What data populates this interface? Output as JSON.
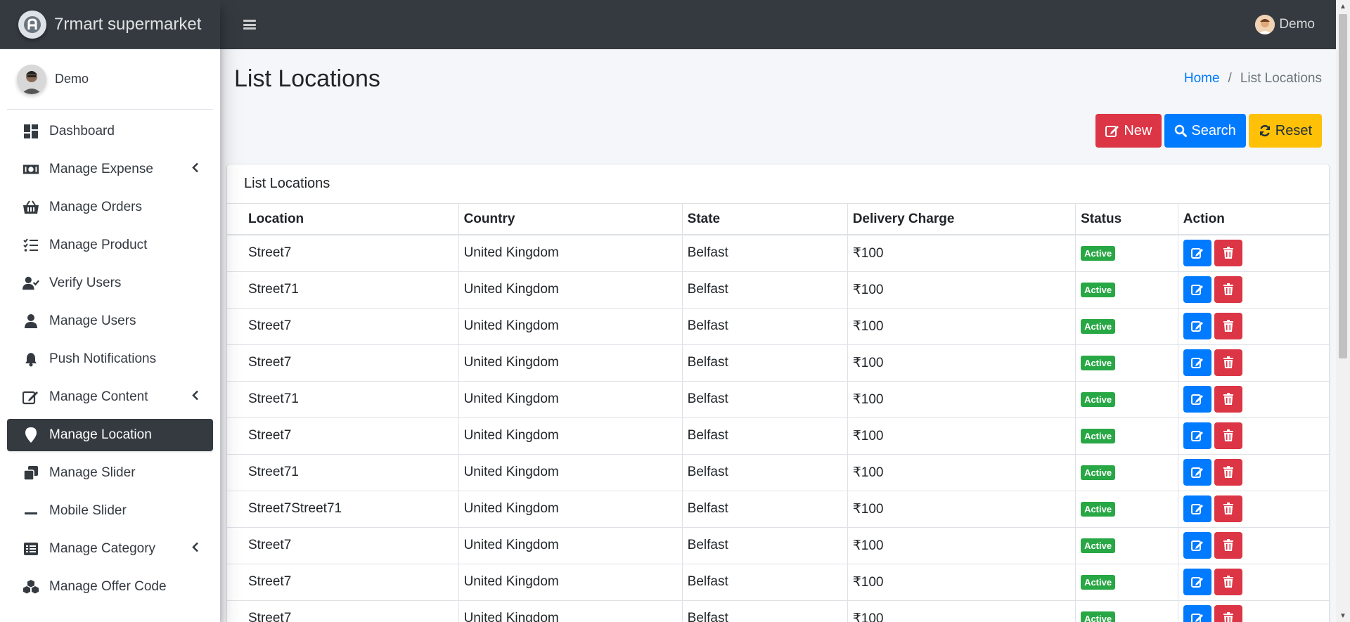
{
  "app": {
    "brand": "7rmart supermarket"
  },
  "sidebar": {
    "user_name": "Demo",
    "items": [
      {
        "label": "Dashboard",
        "icon": "dashboard-icon",
        "caret": false,
        "active": false
      },
      {
        "label": "Manage Expense",
        "icon": "money-icon",
        "caret": true,
        "active": false
      },
      {
        "label": "Manage Orders",
        "icon": "basket-icon",
        "caret": false,
        "active": false
      },
      {
        "label": "Manage Product",
        "icon": "tasks-icon",
        "caret": false,
        "active": false
      },
      {
        "label": "Verify Users",
        "icon": "user-check-icon",
        "caret": false,
        "active": false
      },
      {
        "label": "Manage Users",
        "icon": "user-icon",
        "caret": false,
        "active": false
      },
      {
        "label": "Push Notifications",
        "icon": "bell-icon",
        "caret": false,
        "active": false
      },
      {
        "label": "Manage Content",
        "icon": "edit-icon",
        "caret": true,
        "active": false
      },
      {
        "label": "Manage Location",
        "icon": "map-marker-icon",
        "caret": false,
        "active": true
      },
      {
        "label": "Manage Slider",
        "icon": "clone-icon",
        "caret": false,
        "active": false
      },
      {
        "label": "Mobile Slider",
        "icon": "minus-icon",
        "caret": false,
        "active": false
      },
      {
        "label": "Manage Category",
        "icon": "list-alt-icon",
        "caret": true,
        "active": false
      },
      {
        "label": "Manage Offer Code",
        "icon": "cubes-icon",
        "caret": false,
        "active": false
      }
    ]
  },
  "topbar": {
    "user_name": "Demo"
  },
  "header": {
    "title": "List Locations"
  },
  "breadcrumb": {
    "home": "Home",
    "separator": "/",
    "current": "List Locations"
  },
  "toolbar": {
    "new_label": "New",
    "search_label": "Search",
    "reset_label": "Reset"
  },
  "table": {
    "title": "List Locations",
    "columns": [
      "Location",
      "Country",
      "State",
      "Delivery Charge",
      "Status",
      "Action"
    ],
    "rows": [
      [
        "Street7",
        "United Kingdom",
        "Belfast",
        "₹100",
        "Active"
      ],
      [
        "Street71",
        "United Kingdom",
        "Belfast",
        "₹100",
        "Active"
      ],
      [
        "Street7",
        "United Kingdom",
        "Belfast",
        "₹100",
        "Active"
      ],
      [
        "Street7",
        "United Kingdom",
        "Belfast",
        "₹100",
        "Active"
      ],
      [
        "Street71",
        "United Kingdom",
        "Belfast",
        "₹100",
        "Active"
      ],
      [
        "Street7",
        "United Kingdom",
        "Belfast",
        "₹100",
        "Active"
      ],
      [
        "Street71",
        "United Kingdom",
        "Belfast",
        "₹100",
        "Active"
      ],
      [
        "Street7Street71",
        "United Kingdom",
        "Belfast",
        "₹100",
        "Active"
      ],
      [
        "Street7",
        "United Kingdom",
        "Belfast",
        "₹100",
        "Active"
      ],
      [
        "Street7",
        "United Kingdom",
        "Belfast",
        "₹100",
        "Active"
      ],
      [
        "Street7",
        "United Kingdom",
        "Belfast",
        "₹100",
        "Active"
      ]
    ]
  },
  "colors": {
    "dark": "#343a40",
    "primary": "#007bff",
    "danger": "#dc3545",
    "warning": "#ffc107",
    "success": "#28a745"
  }
}
